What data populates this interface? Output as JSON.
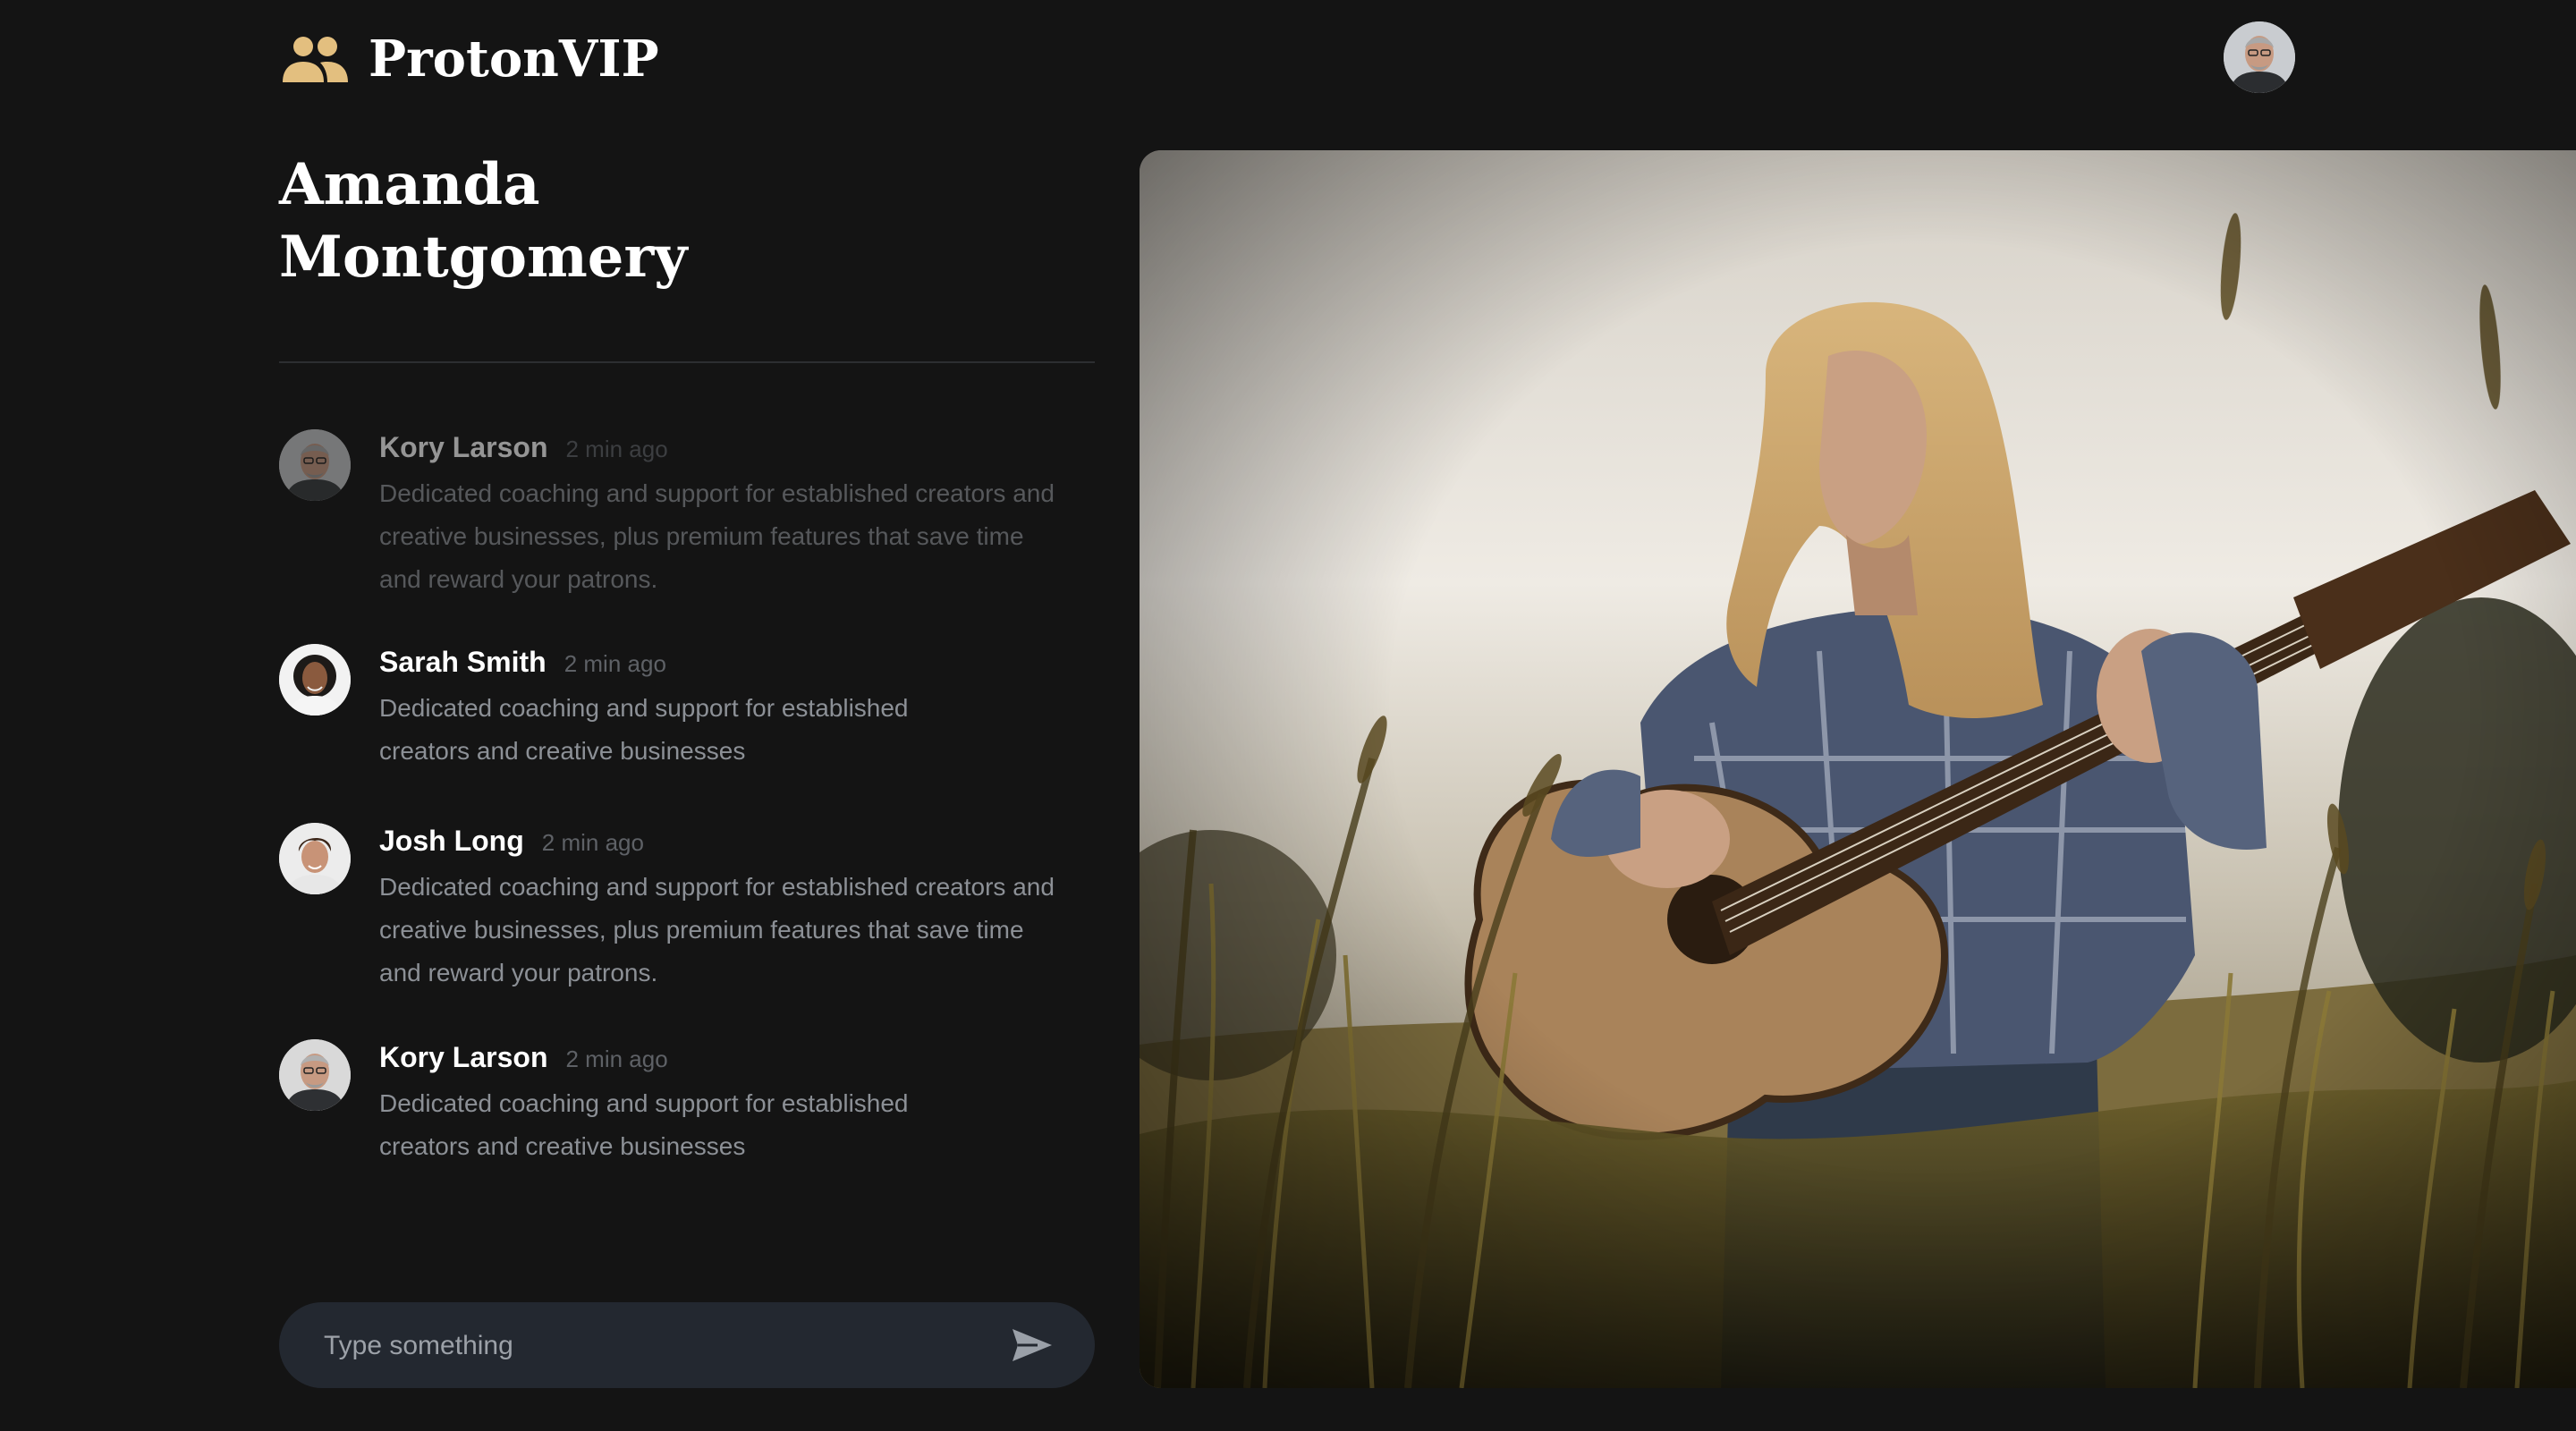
{
  "app": {
    "brand_name": "ProtonVIP",
    "brand_icon": "people-icon",
    "accent_color": "#e3bf7f"
  },
  "profile": {
    "name_line1": "Amanda",
    "name_line2": "Montgomery"
  },
  "messages": [
    {
      "author": "Kory Larson",
      "time": "2 min ago",
      "text": "Dedicated coaching and support for established creators and creative businesses, plus premium features that save time and reward your patrons.",
      "faded": true
    },
    {
      "author": "Sarah Smith",
      "time": "2 min ago",
      "text": "Dedicated coaching and support for established creators and creative businesses",
      "faded": false
    },
    {
      "author": "Josh Long",
      "time": "2 min ago",
      "text": "Dedicated coaching and support for established creators and creative businesses, plus premium features that save time and reward your patrons.",
      "faded": false
    },
    {
      "author": "Kory Larson",
      "time": "2 min ago",
      "text": "Dedicated coaching and support for established creators and creative businesses",
      "faded": false
    }
  ],
  "composer": {
    "placeholder": "Type something",
    "send_icon": "send-icon"
  }
}
